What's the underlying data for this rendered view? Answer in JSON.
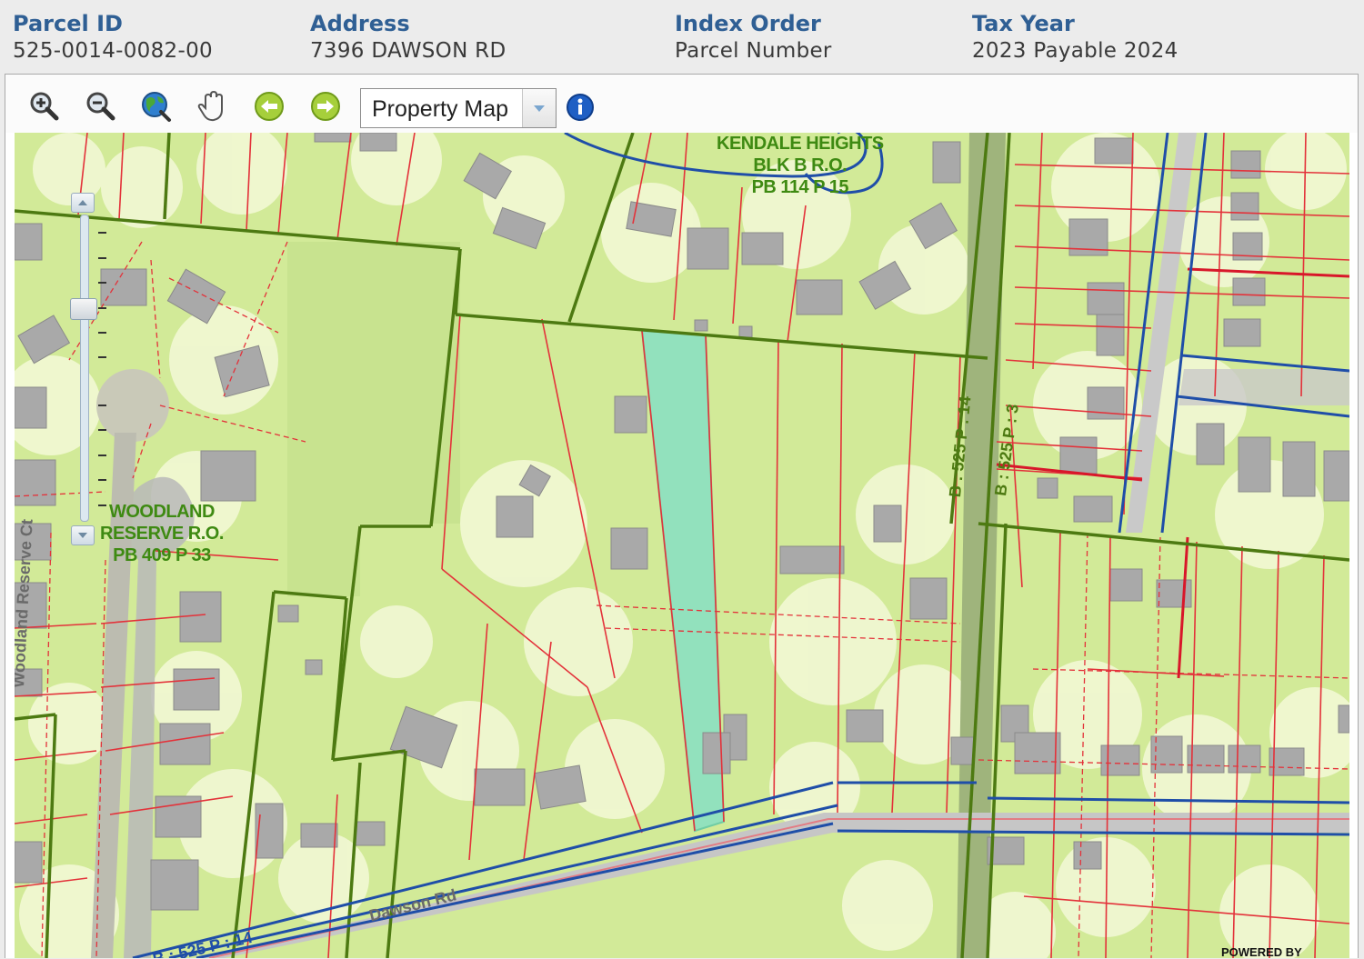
{
  "header": {
    "parcel_id": {
      "label": "Parcel ID",
      "value": "525-0014-0082-00"
    },
    "address": {
      "label": "Address",
      "value": "7396 DAWSON RD"
    },
    "index_order": {
      "label": "Index Order",
      "value": "Parcel Number"
    },
    "tax_year": {
      "label": "Tax Year",
      "value": "2023 Payable 2024"
    }
  },
  "toolbar": {
    "tools": [
      "zoom-in-icon",
      "zoom-out-icon",
      "globe-icon",
      "pan-hand-icon",
      "back-arrow-icon",
      "forward-arrow-icon",
      "info-icon"
    ],
    "map_select": {
      "selected": "Property Map"
    }
  },
  "map": {
    "labels": {
      "kendale": [
        "KENDALE HEIGHTS",
        "BLK B R.O.",
        "PB 114 P 15"
      ],
      "woodland": [
        "WOODLAND",
        "RESERVE R.O.",
        "PB 409 P 33"
      ],
      "woodland_ct": "Woodland Reserve Ct",
      "dawson_rd": "Dawson Rd",
      "book_a": "B : 525    P : 14",
      "book_b": "B : 525    P : 3",
      "book_c": "B : 525    P : 14"
    },
    "zoom_ticks": 12,
    "colors": {
      "background": "#d2ea98",
      "lot_line": "#e3323a",
      "book_line": "#4d7a12",
      "road_line": "#1f4ea8",
      "selected_parcel": "#88e0c4"
    },
    "powered_by": "POWERED BY"
  }
}
